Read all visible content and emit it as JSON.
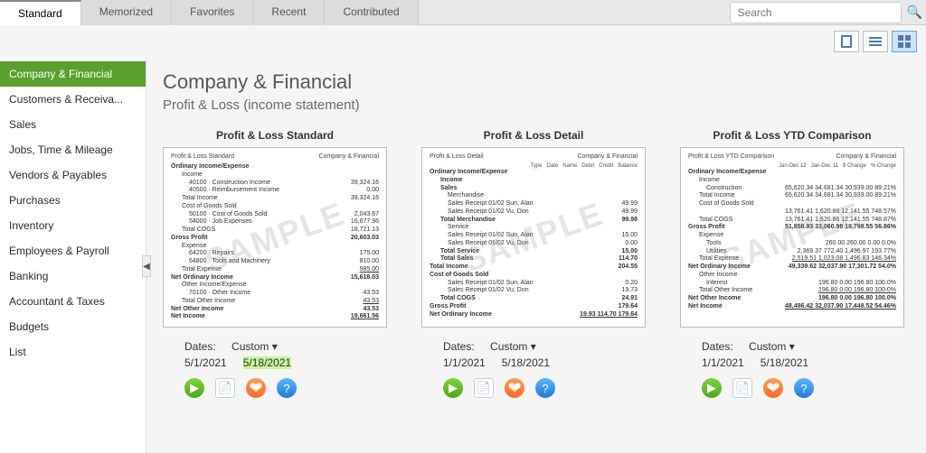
{
  "tabs": [
    "Standard",
    "Memorized",
    "Favorites",
    "Recent",
    "Contributed"
  ],
  "active_tab": 0,
  "search_placeholder": "Search",
  "sidebar": {
    "items": [
      "Company & Financial",
      "Customers & Receiva...",
      "Sales",
      "Jobs, Time & Mileage",
      "Vendors & Payables",
      "Purchases",
      "Inventory",
      "Employees & Payroll",
      "Banking",
      "Accountant & Taxes",
      "Budgets",
      "List"
    ],
    "active": 0
  },
  "page": {
    "title": "Company & Financial",
    "subtitle": "Profit & Loss (income statement)"
  },
  "cards": [
    {
      "title": "Profit & Loss Standard",
      "thumb_left": "Profit & Loss Standard",
      "thumb_right": "Company & Financial",
      "dates_label": "Dates:",
      "dates_value": "Custom",
      "date_from": "5/1/2021",
      "date_to": "5/18/2021",
      "highlight_to": true
    },
    {
      "title": "Profit & Loss Detail",
      "thumb_left": "Profit & Loss Detail",
      "thumb_right": "Company & Financial",
      "dates_label": "Dates:",
      "dates_value": "Custom",
      "date_from": "1/1/2021",
      "date_to": "5/18/2021",
      "highlight_to": false
    },
    {
      "title": "Profit & Loss YTD Comparison",
      "thumb_left": "Profit & Loss YTD Comparison",
      "thumb_right": "Company & Financial",
      "dates_label": "Dates:",
      "dates_value": "Custom",
      "date_from": "1/1/2021",
      "date_to": "5/18/2021",
      "highlight_to": false
    }
  ],
  "sample_watermark": "SAMPLE",
  "thumb_data": {
    "standard": [
      {
        "cls": "b",
        "l": "Ordinary Income/Expense",
        "r": ""
      },
      {
        "cls": "sub",
        "l": "Income",
        "r": ""
      },
      {
        "cls": "sub2",
        "l": "40100 · Construction Income",
        "r": "39,324.16"
      },
      {
        "cls": "sub2",
        "l": "40500 · Reimbursement Income",
        "r": "0.00"
      },
      {
        "cls": "sub",
        "l": "Total Income",
        "r": "39,324.16"
      },
      {
        "cls": "sub",
        "l": "Cost of Goods Sold",
        "r": ""
      },
      {
        "cls": "sub2",
        "l": "50100 · Cost of Goods Sold",
        "r": "2,043.67"
      },
      {
        "cls": "sub2",
        "l": "54000 · Job Expenses",
        "r": "16,677.96"
      },
      {
        "cls": "sub",
        "l": "Total COGS",
        "r": "18,721.13"
      },
      {
        "cls": "b",
        "l": "Gross Profit",
        "r": "20,603.03"
      },
      {
        "cls": "sub",
        "l": "Expense",
        "r": ""
      },
      {
        "cls": "sub2",
        "l": "64200 · Repairs",
        "r": "175.00"
      },
      {
        "cls": "sub2",
        "l": "64800 · Tools and Machinery",
        "r": "810.00"
      },
      {
        "cls": "sub total",
        "l": "Total Expense",
        "r": "985.00"
      },
      {
        "cls": "b",
        "l": "Net Ordinary Income",
        "r": "15,618.03"
      },
      {
        "cls": "sub",
        "l": "Other Income/Expense",
        "r": ""
      },
      {
        "cls": "sub2",
        "l": "70100 · Other Income",
        "r": "43.53"
      },
      {
        "cls": "sub total",
        "l": "Total Other Income",
        "r": "43.53"
      },
      {
        "cls": "b",
        "l": "Net Other Income",
        "r": "43.53"
      },
      {
        "cls": "b total",
        "l": "Net Income",
        "r": "19,661.56"
      }
    ],
    "detail": [
      {
        "cls": "b",
        "l": "Ordinary Income/Expense",
        "r": ""
      },
      {
        "cls": "sub b",
        "l": "Income",
        "r": ""
      },
      {
        "cls": "sub b",
        "l": "Sales",
        "r": ""
      },
      {
        "cls": "sub2",
        "l": "Merchandise",
        "r": ""
      },
      {
        "cls": "sub2",
        "l": "Sales Receipt  01/02  Sun, Alan",
        "r": "49.99"
      },
      {
        "cls": "sub2",
        "l": "Sales Receipt  01/02  Vu, Don",
        "r": "49.99"
      },
      {
        "cls": "sub b",
        "l": "Total Merchandise",
        "r": "99.98"
      },
      {
        "cls": "sub2",
        "l": "Service",
        "r": ""
      },
      {
        "cls": "sub2",
        "l": "Sales Receipt  01/02  Sun, Alan",
        "r": "15.00"
      },
      {
        "cls": "sub2",
        "l": "Sales Receipt  01/02  Vu, Don",
        "r": "0.00"
      },
      {
        "cls": "sub b",
        "l": "Total Service",
        "r": "15.00"
      },
      {
        "cls": "sub b",
        "l": "Total Sales",
        "r": "114.70"
      },
      {
        "cls": "b",
        "l": "Total Income",
        "r": "204.55"
      },
      {
        "cls": "b",
        "l": "Cost of Goods Sold",
        "r": ""
      },
      {
        "cls": "sub2",
        "l": "Sales Receipt  01/02  Sun, Alan",
        "r": "0.20"
      },
      {
        "cls": "sub2",
        "l": "Sales Receipt  01/02  Vu, Don",
        "r": "19.73"
      },
      {
        "cls": "sub b",
        "l": "Total COGS",
        "r": "24.91"
      },
      {
        "cls": "b",
        "l": "Gross Profit",
        "r": "179.64"
      },
      {
        "cls": "b total",
        "l": "Net Ordinary Income",
        "r": "19.93   114.70   179.64"
      }
    ],
    "ytd": [
      {
        "cls": "b",
        "l": "Ordinary Income/Expense",
        "r": ""
      },
      {
        "cls": "sub",
        "l": "Income",
        "r": ""
      },
      {
        "cls": "sub2",
        "l": "Construction",
        "r": "65,620.34   34,681.34   30,939.00   89.21%"
      },
      {
        "cls": "sub",
        "l": "Total Income",
        "r": "65,620.34   34,681.34   30,939.00   89.21%"
      },
      {
        "cls": "sub",
        "l": "Cost of Goods Sold",
        "r": ""
      },
      {
        "cls": "sub2",
        "l": "",
        "r": "13,761.41   1,620.86   12,141.55   748.57%"
      },
      {
        "cls": "sub",
        "l": "Total COGS",
        "r": "13,761.41   1,620.86   12,141.55   748.87%"
      },
      {
        "cls": "b",
        "l": "Gross Profit",
        "r": "51,858.93   33,060.98   18,798.55   56.86%"
      },
      {
        "cls": "sub",
        "l": "Expense",
        "r": ""
      },
      {
        "cls": "sub2",
        "l": "Tools",
        "r": "260.00   260.00   0.00   0.0%"
      },
      {
        "cls": "sub2",
        "l": "Utilities",
        "r": "2,369.37   772.40   1,496.97   193.77%"
      },
      {
        "cls": "sub total",
        "l": "Total Expense",
        "r": "2,519.51   1,023.08   1,496.83   146.34%"
      },
      {
        "cls": "b",
        "l": "Net Ordinary Income",
        "r": "49,339.62   32,037.90   17,301.72   54.0%"
      },
      {
        "cls": "sub",
        "l": "Other Income",
        "r": ""
      },
      {
        "cls": "sub2",
        "l": "Interest",
        "r": "196.80   0.00   196.80   100.0%"
      },
      {
        "cls": "sub total",
        "l": "Total Other Income",
        "r": "196.80   0.00   196.80   100.0%"
      },
      {
        "cls": "b",
        "l": "Net Other Income",
        "r": "196.80   0.00   196.80   100.0%"
      },
      {
        "cls": "b total",
        "l": "Net Income",
        "r": "48,486.42   32,037.90   17,448.52   54.46%"
      }
    ]
  }
}
